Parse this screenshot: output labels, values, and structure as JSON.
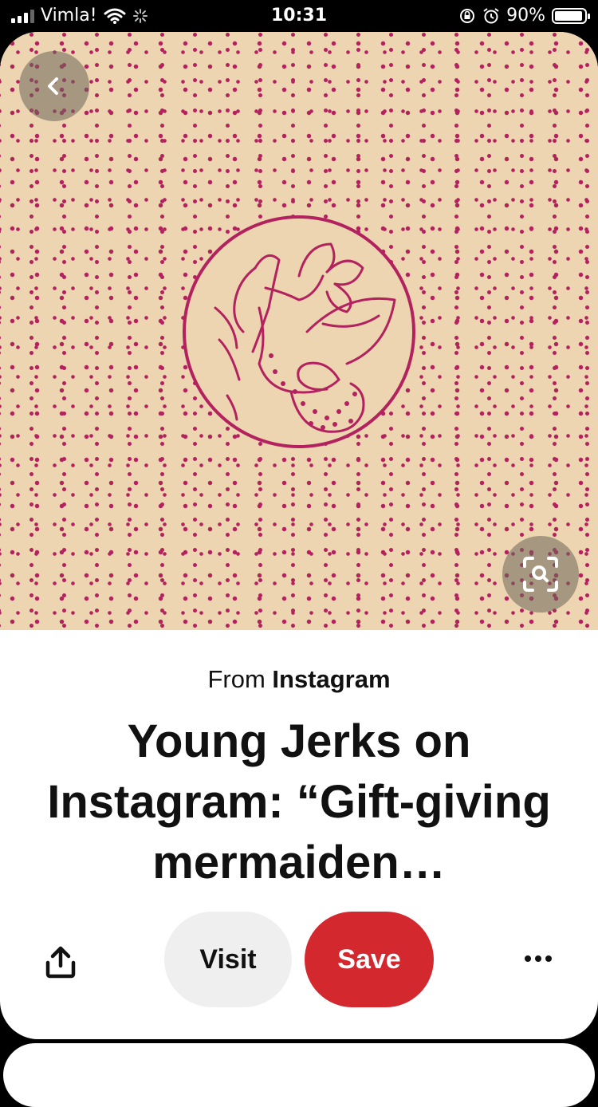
{
  "status_bar": {
    "carrier": "Vimla!",
    "time": "10:31",
    "battery_percent": "90%",
    "battery_level": 0.9
  },
  "pin": {
    "source_prefix": "From",
    "source_name": "Instagram",
    "title": "Young Jerks on Instagram: “Gift-giving mermaiden…",
    "colors": {
      "background": "#ecd5b0",
      "dots": "#b3225f",
      "save": "#d2282e"
    }
  },
  "actions": {
    "visit_label": "Visit",
    "save_label": "Save"
  },
  "icons": {
    "back": "chevron-left-icon",
    "visual_search": "lens-search-icon",
    "share": "share-icon",
    "more": "more-horizontal-icon"
  }
}
